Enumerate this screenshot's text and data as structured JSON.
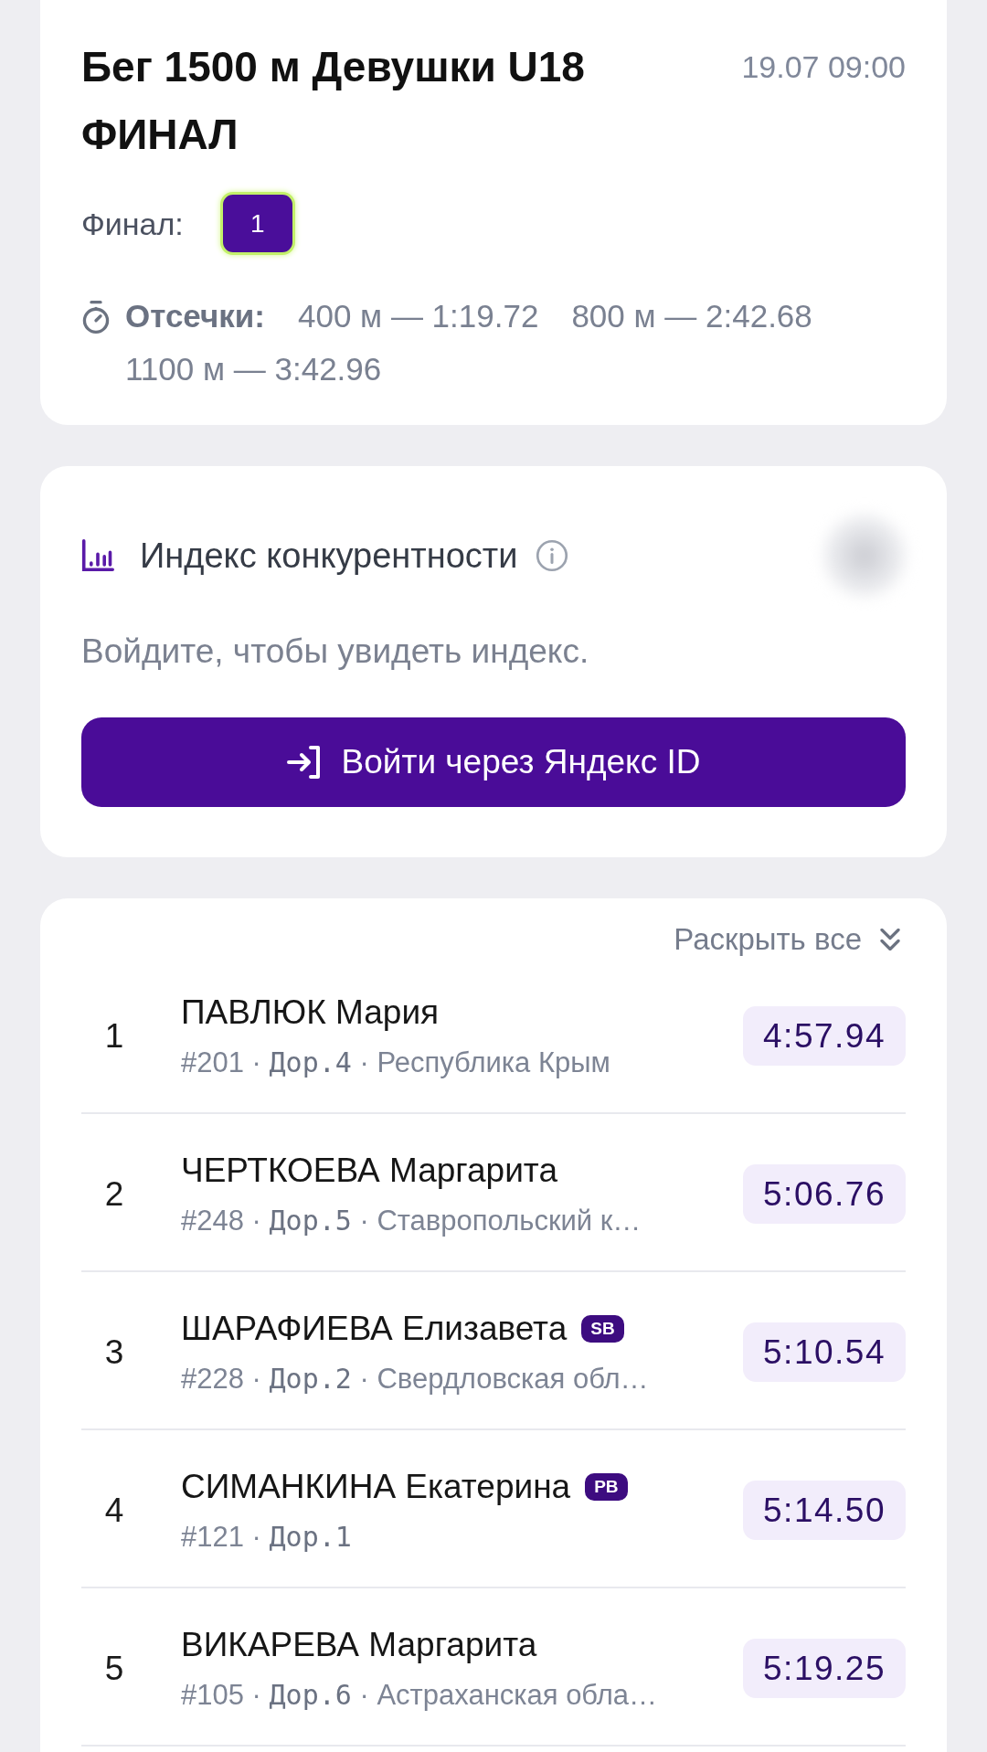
{
  "event": {
    "title": "Бег 1500 м Девушки U18 ФИНАЛ",
    "datetime": "19.07 09:00",
    "heats": {
      "label": "Финал:",
      "items": [
        {
          "label": "1",
          "selected": true
        }
      ]
    },
    "splits": {
      "label": "Отсечки:",
      "items": [
        "400 м — 1:19.72",
        "800 м — 2:42.68",
        "1100 м — 3:42.96"
      ]
    }
  },
  "competitiveness": {
    "title": "Индекс конкурентности",
    "message": "Войдите, чтобы увидеть индекс.",
    "login_button": "Войти через Яндекс ID"
  },
  "results": {
    "expand_all": "Раскрыть все",
    "rows": [
      {
        "place": "1",
        "name": "ПАВЛЮК Мария",
        "details": "#201 · **Дор.4** · Республика Крым",
        "time": "4:57.94"
      },
      {
        "place": "2",
        "name": "ЧЕРТКОЕВА Маргарита",
        "details": "#248 · **Дор.5** · Ставропольский к…",
        "time": "5:06.76"
      },
      {
        "place": "3",
        "name": "ШАРАФИЕВА Елизавета",
        "badge": "SB",
        "details": "#228 · **Дор.2** · Свердловская обл…",
        "time": "5:10.54"
      },
      {
        "place": "4",
        "name": "СИМАНКИНА Екатерина",
        "badge": "PB",
        "details": "#121 · **Дор.1**",
        "time": "5:14.50"
      },
      {
        "place": "5",
        "name": "ВИКАРЕВА Маргарита",
        "details": "#105 · **Дор.6** · Астраханская обла…",
        "time": "5:19.25"
      }
    ]
  }
}
